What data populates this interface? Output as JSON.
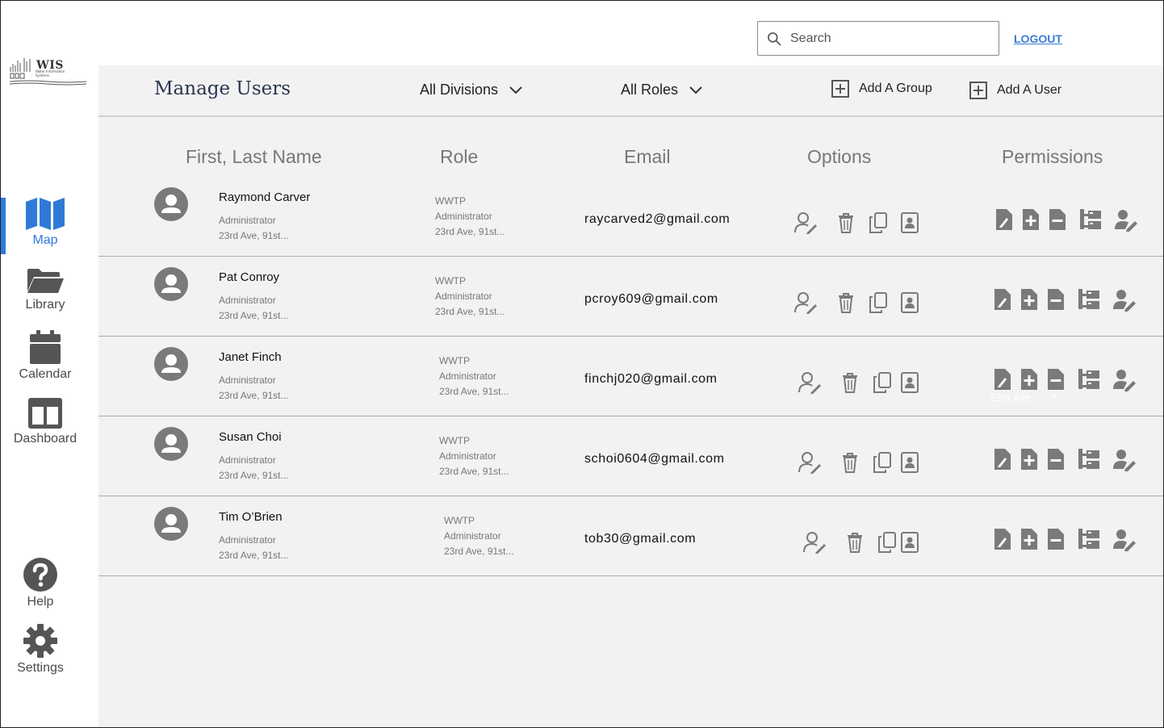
{
  "app": {
    "logo_text": "WIS"
  },
  "search": {
    "placeholder": "Search"
  },
  "header": {
    "logout_label": "LOGOUT"
  },
  "sidebar": {
    "items": [
      {
        "label": "Map",
        "icon": "map-icon",
        "active": true
      },
      {
        "label": "Library",
        "icon": "folder-icon"
      },
      {
        "label": "Calendar",
        "icon": "calendar-icon"
      },
      {
        "label": "Dashboard",
        "icon": "dashboard-icon"
      },
      {
        "label": "Help",
        "icon": "help-icon"
      },
      {
        "label": "Settings",
        "icon": "gear-icon"
      }
    ]
  },
  "toolbar": {
    "title": "Manage Users",
    "division_filter": "All Divisions",
    "role_filter": "All Roles",
    "add_group_label": "Add A Group",
    "add_user_label": "Add A User"
  },
  "table": {
    "columns": [
      "First, Last Name",
      "Role",
      "Email",
      "Options",
      "Permissions"
    ],
    "rows": [
      {
        "name": "Raymond Carver",
        "title": "Administrator",
        "address": "23rd Ave, 91st...",
        "role_org": "WWTP",
        "role_title": "Administrator",
        "role_address": "23rd Ave, 91st...",
        "email": "raycarved2@gmail.com"
      },
      {
        "name": "Pat Conroy",
        "title": "Administrator",
        "address": "23rd Ave, 91st...",
        "role_org": "WWTP",
        "role_title": "Administrator",
        "role_address": "23rd Ave, 91st...",
        "email": "pcroy609@gmail.com"
      },
      {
        "name": "Janet Finch",
        "title": "Administrator",
        "address": "23rd Ave, 91st...",
        "role_org": "WWTP",
        "role_title": "Administrator",
        "role_address": "23rd Ave, 91st...",
        "email": "finchj020@gmail.com"
      },
      {
        "name": "Susan Choi",
        "title": "Administrator",
        "address": "23rd Ave, 91st...",
        "role_org": "WWTP",
        "role_title": "Administrator",
        "role_address": "23rd Ave, 91st...",
        "email": "schoi0604@gmail.com"
      },
      {
        "name": "Tim O’Brien",
        "title": "Administrator",
        "address": "23rd Ave, 91st...",
        "role_org": "WWTP",
        "role_title": "Administrator",
        "role_address": "23rd Ave, 91st...",
        "email": "tob30@gmail.com"
      }
    ],
    "ghost_text": "23rd Ave",
    "ghost_close": "×"
  },
  "colors": {
    "accent": "#2f7ad8",
    "icon_grey": "#7a7a7a",
    "panel_bg": "#f2f2f2",
    "title": "#2a3550"
  }
}
